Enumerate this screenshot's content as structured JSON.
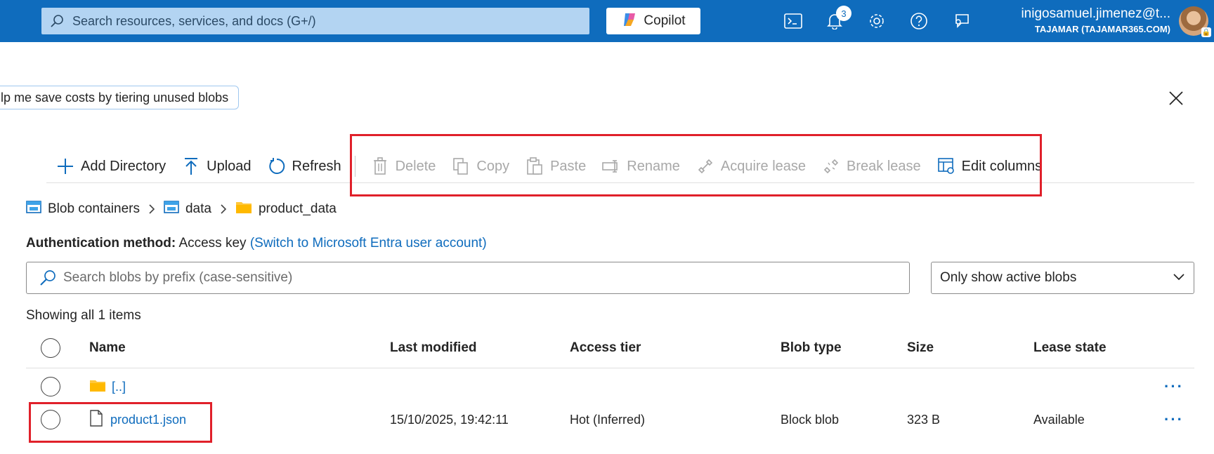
{
  "topbar": {
    "search_placeholder": "Search resources, services, and docs (G+/)",
    "copilot_label": "Copilot",
    "notifications_count": "3",
    "user_name": "inigosamuel.jimenez@t...",
    "tenant": "TAJAMAR (TAJAMAR365.COM)"
  },
  "suggestion_chip": "lp me save costs by tiering unused blobs",
  "toolbar": {
    "items": [
      {
        "label": "Add Directory",
        "icon": "plus-icon",
        "enabled": true
      },
      {
        "label": "Upload",
        "icon": "upload-icon",
        "enabled": true
      },
      {
        "label": "Refresh",
        "icon": "refresh-icon",
        "enabled": true
      },
      {
        "label": "Delete",
        "icon": "trash-icon",
        "enabled": false
      },
      {
        "label": "Copy",
        "icon": "copy-icon",
        "enabled": false
      },
      {
        "label": "Paste",
        "icon": "paste-icon",
        "enabled": false
      },
      {
        "label": "Rename",
        "icon": "rename-icon",
        "enabled": false
      },
      {
        "label": "Acquire lease",
        "icon": "lease-icon",
        "enabled": false
      },
      {
        "label": "Break lease",
        "icon": "break-lease-icon",
        "enabled": false
      },
      {
        "label": "Edit columns",
        "icon": "edit-columns-icon",
        "enabled": true
      }
    ]
  },
  "breadcrumb": {
    "items": [
      "Blob containers",
      "data",
      "product_data"
    ]
  },
  "auth": {
    "label": "Authentication method:",
    "value": "Access key",
    "switch_link": "(Switch to Microsoft Entra user account)"
  },
  "blob_search": {
    "placeholder": "Search blobs by prefix (case-sensitive)"
  },
  "filter": {
    "selected": "Only show active blobs"
  },
  "showing": "Showing all 1 items",
  "table": {
    "columns": [
      "Name",
      "Last modified",
      "Access tier",
      "Blob type",
      "Size",
      "Lease state"
    ],
    "rows": [
      {
        "name": "[..]",
        "type": "folder",
        "last_modified": "",
        "access_tier": "",
        "blob_type": "",
        "size": "",
        "lease_state": ""
      },
      {
        "name": "product1.json",
        "type": "file",
        "last_modified": "15/10/2025, 19:42:11",
        "access_tier": "Hot (Inferred)",
        "blob_type": "Block blob",
        "size": "323 B",
        "lease_state": "Available"
      }
    ],
    "more_label": "···"
  },
  "colors": {
    "brand": "#0f6cbd",
    "highlight": "#e0202a",
    "disabled": "#a8a8a8",
    "folder": "#ffc83d"
  }
}
